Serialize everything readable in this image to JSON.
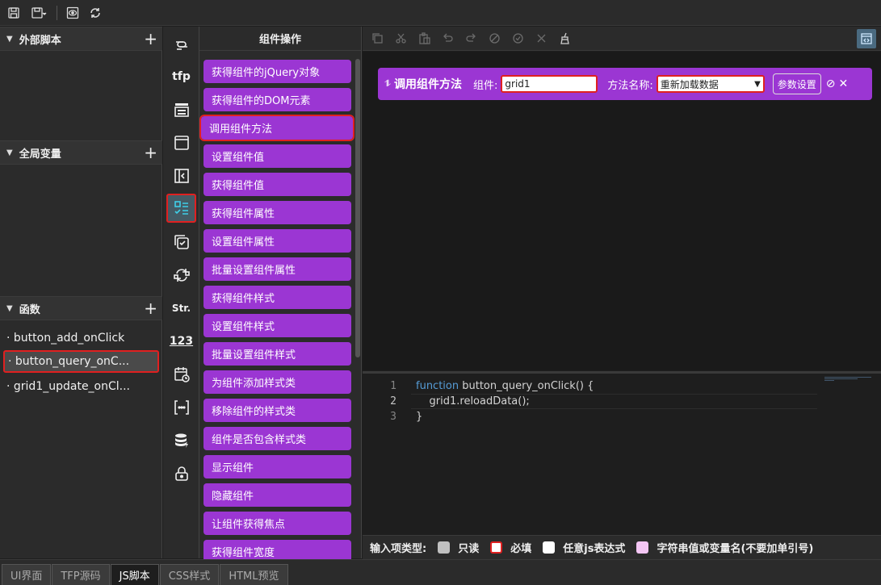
{
  "left_panel": {
    "sections": [
      {
        "title": "外部脚本"
      },
      {
        "title": "全局变量"
      },
      {
        "title": "函数"
      }
    ],
    "functions": [
      {
        "label": "· button_add_onClick"
      },
      {
        "label": "· button_query_onC..."
      },
      {
        "label": "· grid1_update_onCl..."
      }
    ]
  },
  "icon_strip": {
    "items": [
      {
        "name": "link-icon"
      },
      {
        "name": "tfp-icon",
        "text": "tfp"
      },
      {
        "name": "form-icon"
      },
      {
        "name": "window-icon"
      },
      {
        "name": "panel-collapse-icon"
      },
      {
        "name": "component-ops-icon"
      },
      {
        "name": "checkbox-copy-icon"
      },
      {
        "name": "refresh-loop-icon"
      },
      {
        "name": "string-icon",
        "text": "Str."
      },
      {
        "name": "number-icon",
        "text": "123"
      },
      {
        "name": "calendar-clock-icon"
      },
      {
        "name": "array-icon"
      },
      {
        "name": "database-icon"
      },
      {
        "name": "lock-icon"
      }
    ]
  },
  "ops_panel": {
    "title": "组件操作",
    "buttons": [
      "获得组件的jQuery对象",
      "获得组件的DOM元素",
      "调用组件方法",
      "设置组件值",
      "获得组件值",
      "获得组件属性",
      "设置组件属性",
      "批量设置组件属性",
      "获得组件样式",
      "设置组件样式",
      "批量设置组件样式",
      "为组件添加样式类",
      "移除组件的样式类",
      "组件是否包含样式类",
      "显示组件",
      "隐藏组件",
      "让组件获得焦点",
      "获得组件宽度"
    ]
  },
  "block": {
    "title": "调用组件方法",
    "component_label": "组件:",
    "component_value": "grid1",
    "method_label": "方法名称:",
    "method_value": "重新加载数据",
    "param_button": "参数设置",
    "handle": "⥮"
  },
  "code": {
    "line_numbers": [
      "1",
      "2",
      "3"
    ],
    "keyword": "function",
    "line1_rest": " button_query_onClick() {",
    "line2": "    grid1.reloadData();",
    "line3": "}"
  },
  "legend": {
    "title": "输入项类型:",
    "items": [
      {
        "label": "只读",
        "color": "#c0c0c0"
      },
      {
        "label": "必填",
        "color": "#ffffff"
      },
      {
        "label": "任意js表达式",
        "color": "#ffffff"
      },
      {
        "label": "字符串值或变量名(不要加单引号)",
        "color": "#f4c6f4"
      }
    ]
  },
  "tabs": [
    {
      "label": "UI界面"
    },
    {
      "label": "TFP源码"
    },
    {
      "label": "JS脚本",
      "active": true
    },
    {
      "label": "CSS样式"
    },
    {
      "label": "HTML预览"
    }
  ],
  "colors": {
    "accent_purple": "#9b36d3",
    "highlight_red": "#e02020",
    "keyword_blue": "#569cd6"
  }
}
